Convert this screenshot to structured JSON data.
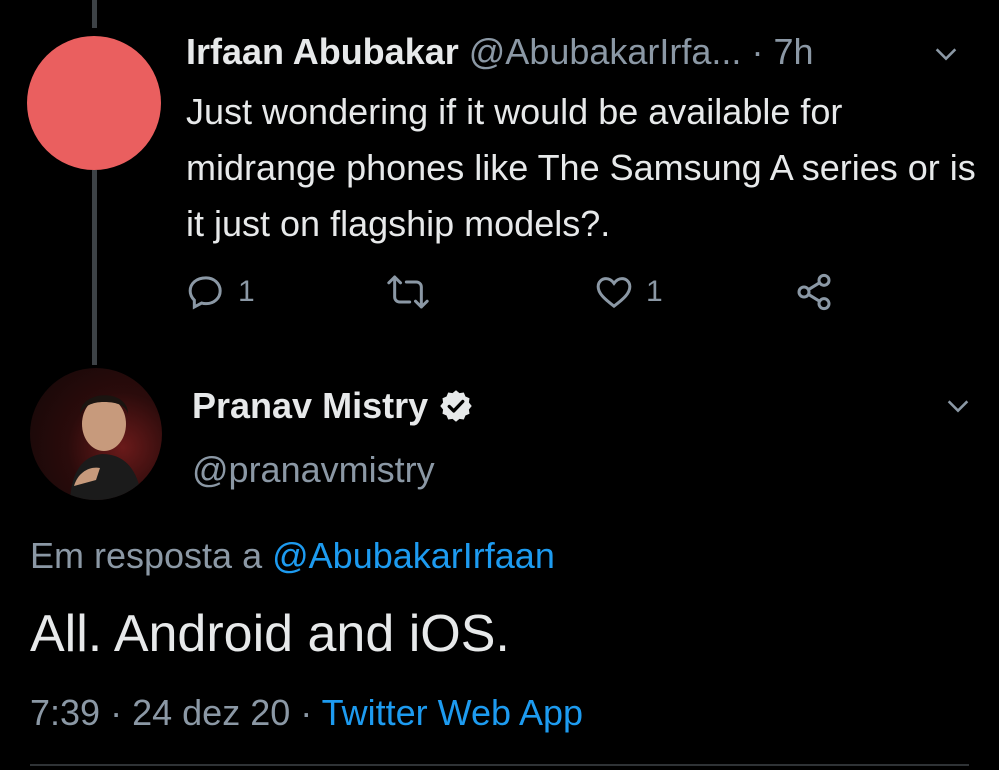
{
  "colors": {
    "background": "#000000",
    "text": "#e7e9ea",
    "muted": "#8b98a5",
    "link": "#1d9bf0",
    "avatar_red": "#ea5f5f"
  },
  "tweet1": {
    "name": "Irfaan Abubakar",
    "handle": "@AbubakarIrfa...",
    "time": "· 7h",
    "text": "Just wondering if it would be available for midrange phones like The Samsung A series or is it just on flagship models?.",
    "actions": {
      "reply_icon": "reply-icon",
      "reply_count": "1",
      "retweet_icon": "retweet-icon",
      "like_icon": "heart-icon",
      "like_count": "1",
      "share_icon": "share-icon"
    }
  },
  "tweet2": {
    "name": "Pranav Mistry",
    "verified_icon": "verified-badge-icon",
    "handle": "@pranavmistry",
    "reply_prefix": "Em resposta a",
    "reply_to": "@AbubakarIrfaan",
    "text": "All. Android and iOS.",
    "time": "7:39",
    "date": "24 dez 20",
    "sep": "·",
    "source": "Twitter Web App"
  }
}
